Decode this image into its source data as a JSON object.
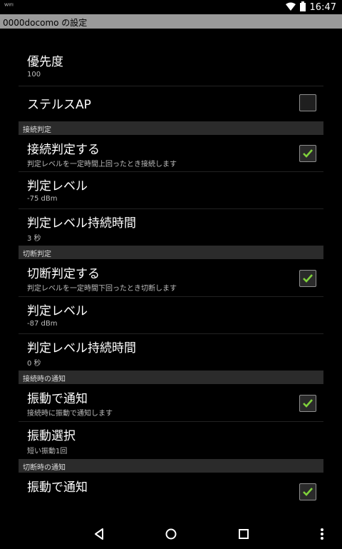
{
  "status_bar": {
    "time": "16:47",
    "left_icons": "ᵂᴵᶠᴵ",
    "icons": [
      "wifi-icon",
      "battery-icon"
    ]
  },
  "title_bar": {
    "title": "0000docomo の設定"
  },
  "prefs": {
    "priority": {
      "title": "優先度",
      "summary": "100"
    },
    "stealth": {
      "title": "ステルスAP",
      "checked": false
    },
    "cat_connect": "接続判定",
    "connect_judge": {
      "title": "接続判定する",
      "summary": "判定レベルを一定時間上回ったとき接続します",
      "checked": true
    },
    "connect_level": {
      "title": "判定レベル",
      "summary": "-75 dBm"
    },
    "connect_duration": {
      "title": "判定レベル持続時間",
      "summary": "3 秒"
    },
    "cat_disconnect": "切断判定",
    "disconnect_judge": {
      "title": "切断判定する",
      "summary": "判定レベルを一定時間下回ったとき切断します",
      "checked": true
    },
    "disconnect_level": {
      "title": "判定レベル",
      "summary": "-87 dBm"
    },
    "disconnect_duration": {
      "title": "判定レベル持続時間",
      "summary": "0 秒"
    },
    "cat_notify_connect": "接続時の通知",
    "vibrate_connect": {
      "title": "振動で通知",
      "summary": "接続時に振動で通知します",
      "checked": true
    },
    "vibrate_select": {
      "title": "振動選択",
      "summary": "短い振動1回"
    },
    "cat_notify_disconnect": "切断時の通知",
    "vibrate_disconnect": {
      "title": "振動で通知",
      "checked": true
    }
  },
  "nav_bar": {
    "buttons": [
      "back-icon",
      "home-icon",
      "recents-icon",
      "menu-icon"
    ]
  },
  "colors": {
    "check_green": "#7fd13b",
    "title_bar_bg": "#9a9a9a",
    "category_bg": "#2b2b2b"
  }
}
